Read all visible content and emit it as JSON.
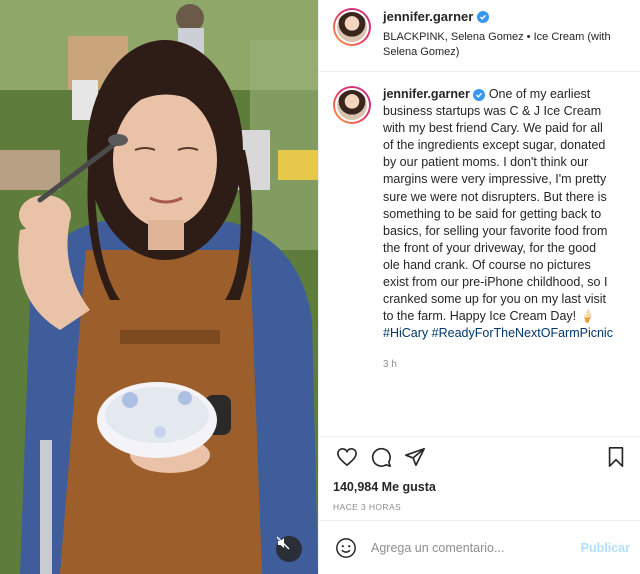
{
  "post": {
    "username": "jennifer.garner",
    "audio": "BLACKPINK, Selena Gomez • Ice Cream (with Selena Gomez)",
    "caption_text": "One of my earliest business startups was C & J Ice Cream with my best friend Cary. We paid for all of the ingredients except sugar, donated by our patient moms. I don't think our margins were very impressive, I'm pretty sure we were not disrupters. But there is something to be said for getting back to basics, for selling your favorite food from the front of your driveway, for the good ole hand crank. Of course no pictures exist from our pre-iPhone childhood, so I cranked some up for you on my last visit to the farm. Happy Ice Cream Day! 🍦",
    "hashtag_1": "#HiCary",
    "hashtag_2": "#ReadyForTheNextOFarmPicnic",
    "caption_time": "3 h",
    "likes": "140,984 Me gusta",
    "posted_ago": "HACE 3 HORAS"
  },
  "comment": {
    "placeholder": "Agrega un comentario...",
    "publish_label": "Publicar"
  },
  "icons": {
    "like": "heart-icon",
    "comment": "comment-icon",
    "share": "paper-plane-icon",
    "save": "bookmark-icon",
    "emoji": "smiley-icon",
    "mute": "speaker-muted-icon",
    "verified": "verified-badge-icon"
  },
  "colors": {
    "verified": "#3897f0",
    "hashtag": "#00376b",
    "publish_disabled": "#b2dffc"
  }
}
